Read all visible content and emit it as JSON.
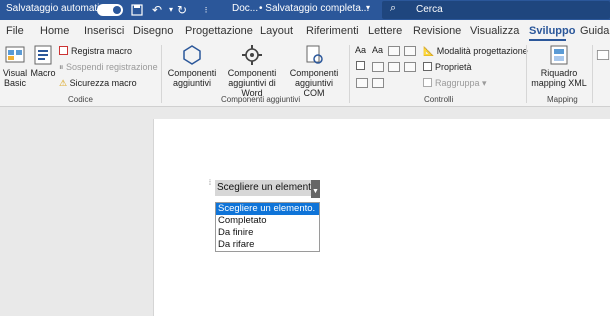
{
  "titlebar": {
    "autosave_label": "Salvataggio automatico",
    "doc_name": "Doc...",
    "status": "• Salvataggio completa...",
    "search_placeholder": "Cerca"
  },
  "tabs": [
    {
      "label": "File"
    },
    {
      "label": "Home"
    },
    {
      "label": "Inserisci"
    },
    {
      "label": "Disegno"
    },
    {
      "label": "Progettazione"
    },
    {
      "label": "Layout"
    },
    {
      "label": "Riferimenti"
    },
    {
      "label": "Lettere"
    },
    {
      "label": "Revisione"
    },
    {
      "label": "Visualizza"
    },
    {
      "label": "Sviluppo"
    },
    {
      "label": "Guida"
    }
  ],
  "ribbon": {
    "codice": {
      "visual_basic": "Visual Basic",
      "macro": "Macro",
      "registra_macro": "Registra macro",
      "sospendi": "Sospendi registrazione",
      "sicurezza": "Sicurezza macro",
      "label": "Codice"
    },
    "componenti": {
      "aggiuntivi": "Componenti aggiuntivi",
      "word": "Componenti aggiuntivi di Word",
      "com": "Componenti aggiuntivi COM",
      "label": "Componenti aggiuntivi"
    },
    "controlli": {
      "modalita": "Modalità progettazione",
      "proprieta": "Proprietà",
      "raggruppa": "Raggruppa",
      "label": "Controlli"
    },
    "mapping": {
      "riquadro": "Riquadro mapping XML",
      "label": "Mapping"
    }
  },
  "document": {
    "control_text": "Scegliere un elemento.",
    "options": [
      "Scegliere un elemento.",
      "Completato",
      "Da finire",
      "Da rifare"
    ]
  },
  "colors": {
    "brand": "#2b579a",
    "selection": "#0f74d8"
  }
}
